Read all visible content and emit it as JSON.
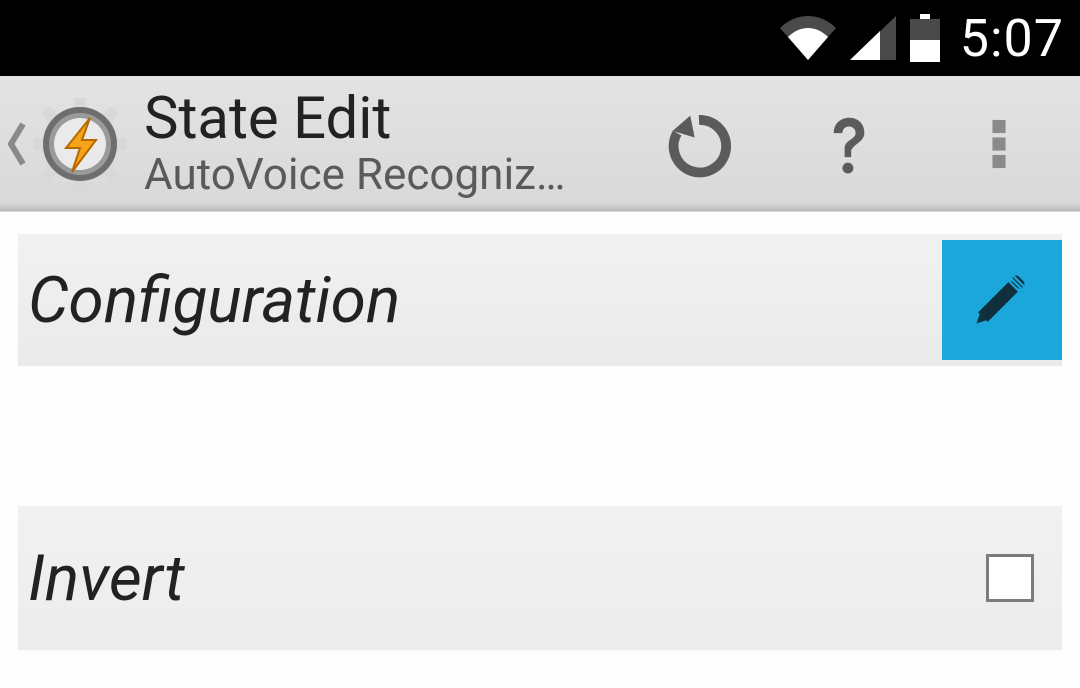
{
  "status": {
    "time": "5:07"
  },
  "actionbar": {
    "title": "State Edit",
    "subtitle": "AutoVoice Recogniz…"
  },
  "sections": {
    "configuration": {
      "label": "Configuration"
    },
    "invert": {
      "label": "Invert",
      "checked": false
    }
  }
}
